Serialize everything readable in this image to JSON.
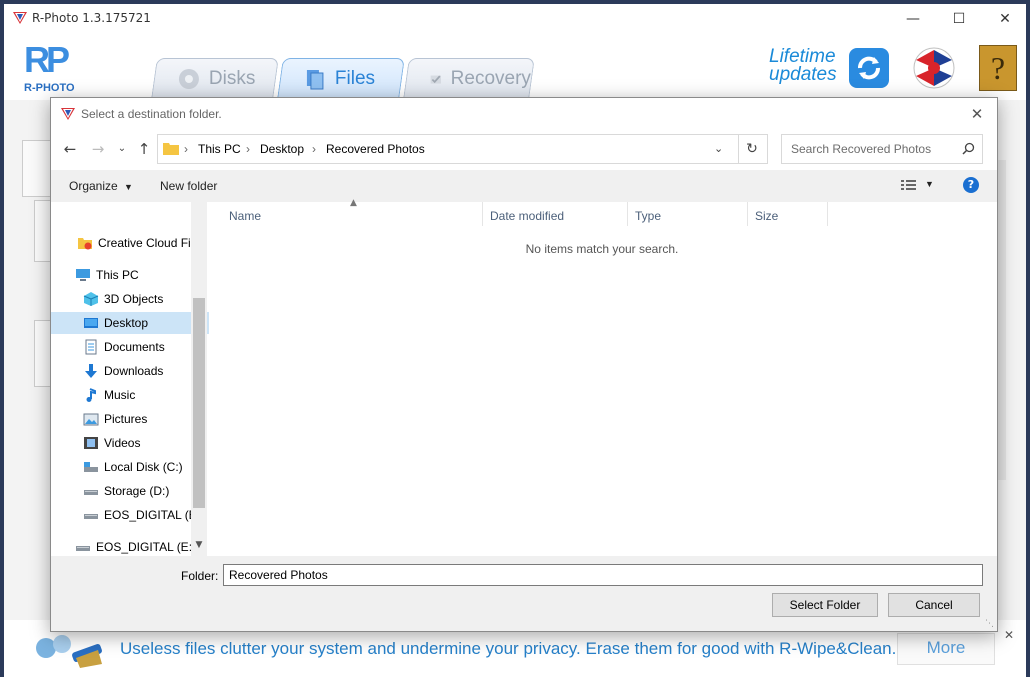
{
  "app": {
    "title": "R-Photo 1.3.175721",
    "logo_text": "RP",
    "logo_sub": "R-PHOTO",
    "tabs": [
      {
        "label": "Disks"
      },
      {
        "label": "Files"
      },
      {
        "label": "Recovery"
      }
    ],
    "lifetime_line1": "Lifetime",
    "lifetime_line2": "updates",
    "help_glyph": "?",
    "promo_text": "Useless files clutter your system and undermine your privacy. Erase them for good with R-Wipe&Clean.",
    "more_label": "More"
  },
  "dialog": {
    "title": "Select a destination folder.",
    "breadcrumb": [
      "This PC",
      "Desktop",
      "Recovered Photos"
    ],
    "search_placeholder": "Search Recovered Photos",
    "toolbar": {
      "organize": "Organize",
      "new_folder": "New folder"
    },
    "nav_items": [
      {
        "label": "Creative Cloud Fil",
        "icon": "creative-cloud-icon"
      },
      {
        "label": "This PC",
        "icon": "computer-icon"
      },
      {
        "label": "3D Objects",
        "icon": "3d-objects-icon"
      },
      {
        "label": "Desktop",
        "icon": "desktop-icon"
      },
      {
        "label": "Documents",
        "icon": "documents-icon"
      },
      {
        "label": "Downloads",
        "icon": "downloads-icon"
      },
      {
        "label": "Music",
        "icon": "music-icon"
      },
      {
        "label": "Pictures",
        "icon": "pictures-icon"
      },
      {
        "label": "Videos",
        "icon": "videos-icon"
      },
      {
        "label": "Local Disk (C:)",
        "icon": "drive-icon"
      },
      {
        "label": "Storage (D:)",
        "icon": "drive-icon"
      },
      {
        "label": "EOS_DIGITAL (E:)",
        "icon": "drive-icon"
      },
      {
        "label": "EOS_DIGITAL (E:)",
        "icon": "drive-icon"
      }
    ],
    "columns": [
      "Name",
      "Date modified",
      "Type",
      "Size"
    ],
    "empty_message": "No items match your search.",
    "folder_label": "Folder:",
    "folder_value": "Recovered Photos",
    "select_button": "Select Folder",
    "cancel_button": "Cancel"
  },
  "colors": {
    "accent": "#2a83d6",
    "selected_bg": "#cce4f7",
    "promo": "#2680c9"
  }
}
